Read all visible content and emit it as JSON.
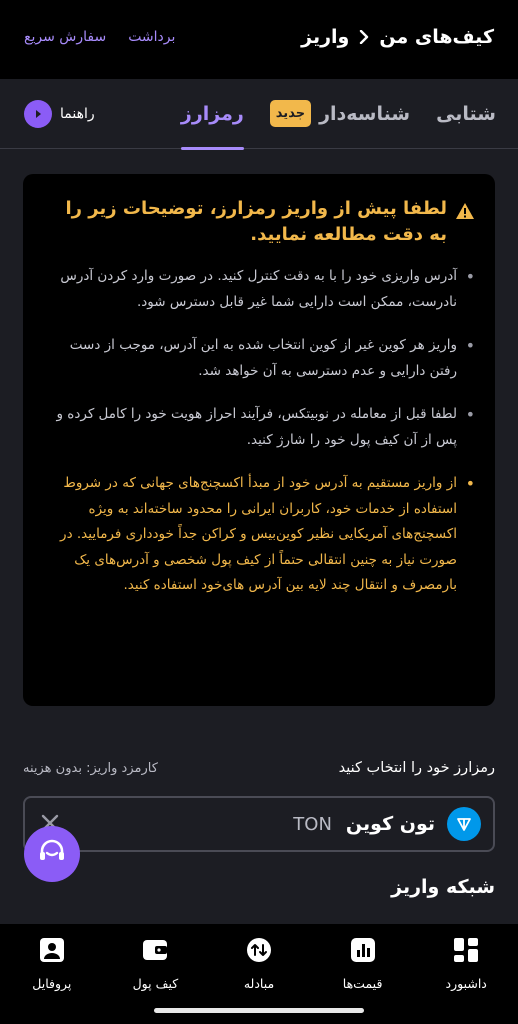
{
  "header": {
    "breadcrumb_parent": "کیف‌های من",
    "breadcrumb_current": "واریز",
    "links": {
      "quick_order": "سفارش سریع",
      "withdraw": "برداشت"
    }
  },
  "tabs": [
    {
      "label": "شتابی"
    },
    {
      "label": "شناسه‌دار",
      "badge": "جدید"
    },
    {
      "label": "رمزارز",
      "active": true
    }
  ],
  "guide": {
    "label": "راهنما"
  },
  "warning": {
    "title": "لطفا پیش از واریز رمزارز، توضیحات زیر را به دقت مطالعه نمایید.",
    "items": [
      "آدرس واریزی خود را با به دقت کنترل کنید. در صورت وارد کردن آدرس نادرست، ممکن است دارایی شما غیر قابل دسترس شود.",
      "واریز هر کوین غیر از کوین انتخاب شده به این آدرس، موجب از دست رفتن دارایی و عدم دسترسی به آن خواهد شد.",
      "لطفا قبل از معامله در نوبیتکس، فرآیند احراز هویت خود را کامل کرده و پس از آن کیف پول خود را شارژ کنید.",
      "از واریز مستقیم به آدرس خود از مبدأ اکسچنج‌های جهانی که در شروط استفاده از خدمات خود، کاربران ایرانی را محدود ساخته‌اند به ویژه اکسچنج‌های آمریکایی نظیر کوین‌بیس و کراکن جداً خودداری فرمایید. در صورت نیاز به چنین انتقالی حتماً از کیف پول شخصی و آدرس‌های یک بارمصرف و انتقال چند لایه بین آدرس های‌خود استفاده کنید."
    ]
  },
  "select": {
    "label": "رمزارز خود را انتخاب کنید",
    "fee": "کارمزد واریز: بدون هزینه",
    "coin_name": "تون کوین",
    "coin_symbol": "TON"
  },
  "network_label": "شبکه واریز",
  "bottom_nav": [
    {
      "label": "داشبورد",
      "icon": "dashboard-icon"
    },
    {
      "label": "قیمت‌ها",
      "icon": "chart-icon"
    },
    {
      "label": "مبادله",
      "icon": "swap-icon"
    },
    {
      "label": "کیف پول",
      "icon": "wallet-icon"
    },
    {
      "label": "پروفایل",
      "icon": "profile-icon"
    }
  ],
  "colors": {
    "accent": "#a78bfa",
    "warning": "#f2b84b",
    "ton_blue": "#0098ea",
    "support": "#8b5cf6"
  }
}
